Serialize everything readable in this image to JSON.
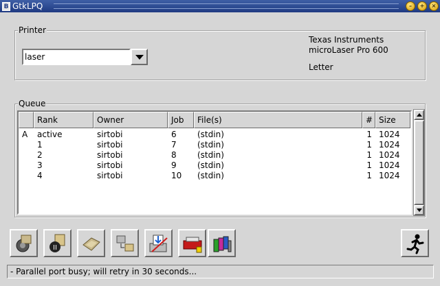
{
  "window": {
    "title": "GtkLPQ",
    "app_icon_glyph": "B",
    "controls": [
      "minimize-icon",
      "maximize-icon",
      "close-icon"
    ]
  },
  "printer": {
    "group_label": "Printer",
    "selected": "laser",
    "manufacturer": "Texas Instruments",
    "model": "microLaser Pro 600",
    "media": "Letter"
  },
  "queue": {
    "group_label": "Queue",
    "columns": [
      "",
      "Rank",
      "Owner",
      "Job",
      "File(s)",
      "#",
      "Size"
    ],
    "rows": [
      [
        "A",
        "active",
        "sirtobi",
        "6",
        "(stdin)",
        "1",
        "1024"
      ],
      [
        "",
        "1",
        "sirtobi",
        "7",
        "(stdin)",
        "1",
        "1024"
      ],
      [
        "",
        "2",
        "sirtobi",
        "8",
        "(stdin)",
        "1",
        "1024"
      ],
      [
        "",
        "3",
        "sirtobi",
        "9",
        "(stdin)",
        "1",
        "1024"
      ],
      [
        "",
        "4",
        "sirtobi",
        "10",
        "(stdin)",
        "1",
        "1024"
      ]
    ]
  },
  "toolbar": {
    "buttons": [
      {
        "name": "remove-job-icon"
      },
      {
        "name": "hold-job-icon"
      },
      {
        "name": "release-job-icon"
      },
      {
        "name": "move-job-icon"
      },
      {
        "name": "print-file-icon"
      },
      {
        "name": "printer-setup-icon"
      },
      {
        "name": "color-settings-icon"
      }
    ],
    "exit_button": {
      "name": "exit-running-man-icon"
    }
  },
  "status": {
    "text": "- Parallel port busy; will retry in 30 seconds..."
  }
}
